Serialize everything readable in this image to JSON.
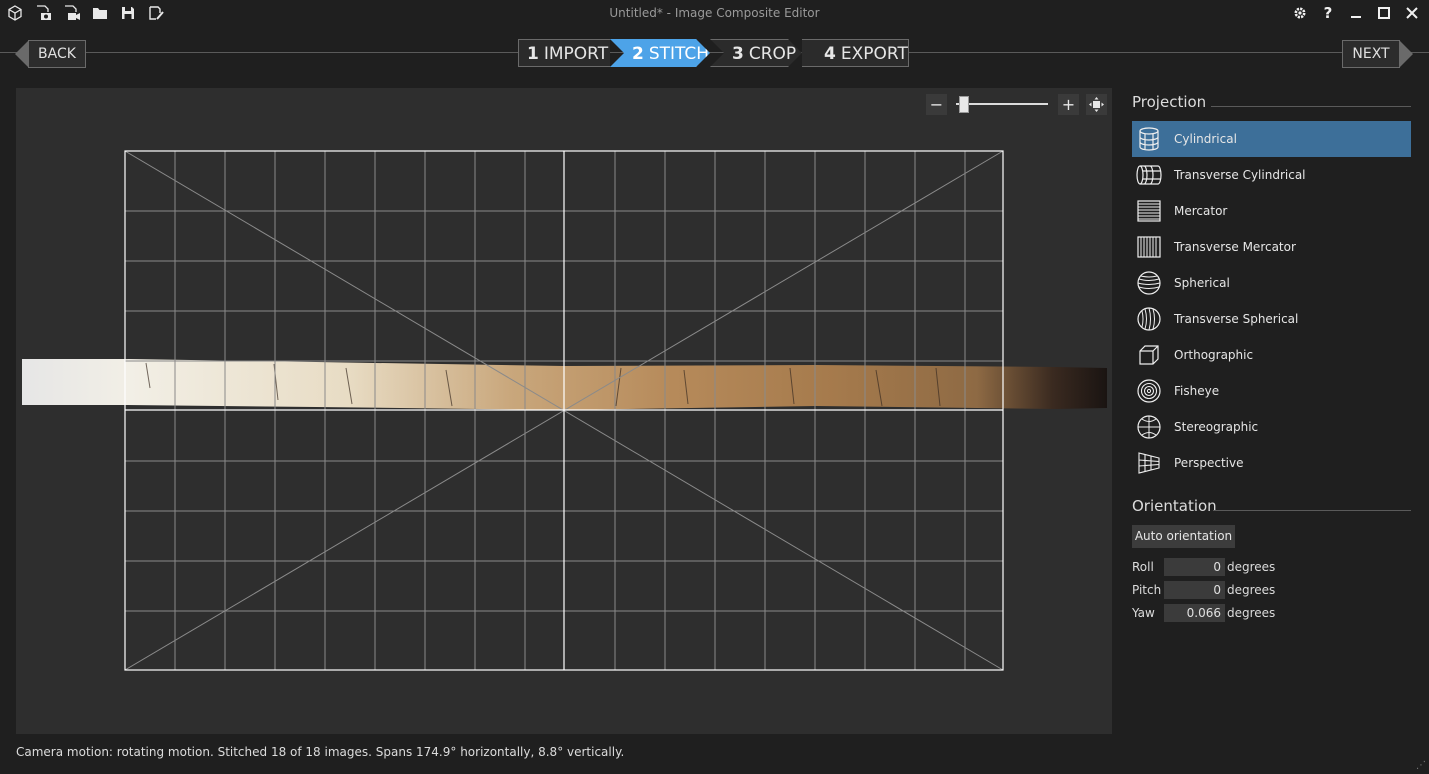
{
  "window": {
    "title": "Untitled* - Image Composite Editor"
  },
  "toolbar": {
    "icons": [
      "new-project-icon",
      "new-from-camera-icon",
      "new-from-video-icon",
      "open-icon",
      "save-icon",
      "export-icon"
    ]
  },
  "window_controls": {
    "icons": [
      "settings-icon",
      "help-icon",
      "minimize-icon",
      "maximize-icon",
      "close-icon"
    ],
    "help_text": "?"
  },
  "nav": {
    "back_label": "BACK",
    "next_label": "NEXT",
    "steps": [
      {
        "num": "1",
        "label": "IMPORT",
        "active": false
      },
      {
        "num": "2",
        "label": "STITCH",
        "active": true
      },
      {
        "num": "3",
        "label": "CROP",
        "active": false
      },
      {
        "num": "4",
        "label": "EXPORT",
        "active": false
      }
    ]
  },
  "zoom": {
    "minus": "−",
    "plus": "+",
    "level_fraction": 0.09
  },
  "projection": {
    "title": "Projection",
    "items": [
      {
        "label": "Cylindrical",
        "icon": "cylindrical-icon",
        "selected": true
      },
      {
        "label": "Transverse Cylindrical",
        "icon": "transverse-cylindrical-icon",
        "selected": false
      },
      {
        "label": "Mercator",
        "icon": "mercator-icon",
        "selected": false
      },
      {
        "label": "Transverse Mercator",
        "icon": "transverse-mercator-icon",
        "selected": false
      },
      {
        "label": "Spherical",
        "icon": "spherical-icon",
        "selected": false
      },
      {
        "label": "Transverse Spherical",
        "icon": "transverse-spherical-icon",
        "selected": false
      },
      {
        "label": "Orthographic",
        "icon": "orthographic-icon",
        "selected": false
      },
      {
        "label": "Fisheye",
        "icon": "fisheye-icon",
        "selected": false
      },
      {
        "label": "Stereographic",
        "icon": "stereographic-icon",
        "selected": false
      },
      {
        "label": "Perspective",
        "icon": "perspective-icon",
        "selected": false
      }
    ]
  },
  "orientation": {
    "title": "Orientation",
    "auto_label": "Auto orientation",
    "roll": {
      "label": "Roll",
      "value": "0",
      "unit": "degrees"
    },
    "pitch": {
      "label": "Pitch",
      "value": "0",
      "unit": "degrees"
    },
    "yaw": {
      "label": "Yaw",
      "value": "0.066",
      "unit": "degrees"
    }
  },
  "status": "Camera motion: rotating motion. Stitched 18 of 18 images. Spans 174.9° horizontally, 8.8° vertically.",
  "colors": {
    "accent": "#4da3e8",
    "selected": "#3d6f99",
    "background": "#1f1f1f",
    "canvas": "#2e2e2e"
  }
}
